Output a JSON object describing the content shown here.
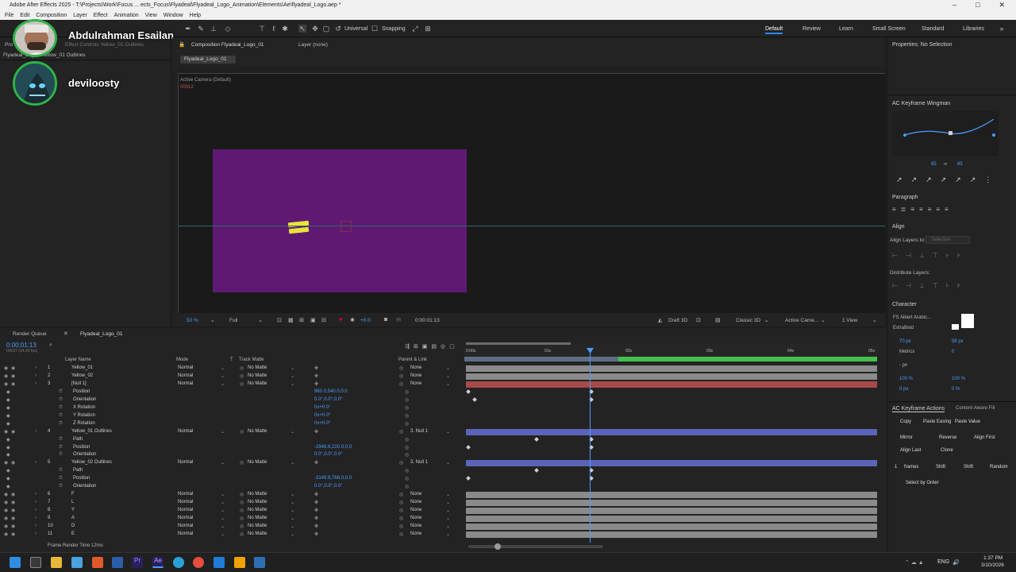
{
  "window": {
    "title": "Adobe After Effects 2025 - T:\\Projects\\Work\\Focus ... ects_Focus\\Flyadeal\\Flyadeal_Logo_Animation\\Elements\\Ae\\flyadeal_Logo.aep *",
    "menu": [
      "File",
      "Edit",
      "Composition",
      "Layer",
      "Effect",
      "Animation",
      "View",
      "Window",
      "Help"
    ]
  },
  "toolbar": {
    "universal_label": "Universal",
    "snapping_label": "Snapping",
    "workspaces": [
      "Default",
      "Review",
      "Learn",
      "Small Screen",
      "Standard",
      "Libraries"
    ],
    "active_workspace": "Default"
  },
  "overlays": {
    "user1": "Abdulrahman Esailan",
    "user2": "deviloosty"
  },
  "project_panel": {
    "label": "Pro",
    "breadcrumb": "Flyadeal_Logo • Yellow_01 Outlines",
    "effect_controls": "Effect Controls Yellow_01 Outlines"
  },
  "comp_panel": {
    "tab": "Composition Flyadeal_Logo_01",
    "layer_tab": "Layer (none)",
    "subtab": "Flyadeal_Logo_01",
    "camera_label": "Active Camera (Default)",
    "top_left_readout": "00012",
    "zoom": "50 %",
    "resolution": "Full",
    "exposure": "+0.0",
    "timecode": "0:00:01:13",
    "draft": "Draft 3D",
    "renderer": "Classic 3D",
    "camera": "Active Came...",
    "views": "1 View"
  },
  "timeline": {
    "tabs": [
      "Render Queue",
      "Flyadeal_Logo_01"
    ],
    "timecode": "0:00:01:13",
    "timecode_sub": "00037 (24.00 fps)",
    "columns": {
      "layer_name": "Layer Name",
      "mode": "Mode",
      "t": "T",
      "track_matte": "Track Matte",
      "parent": "Parent & Link"
    },
    "ruler_ticks": [
      "0:00s",
      "01s",
      "02s",
      "03s",
      "04s",
      "05s"
    ],
    "rows": [
      {
        "num": "1",
        "name": "Yellow_01",
        "mode": "Normal",
        "matte": "No Matte",
        "parent": "None",
        "bar": "#8a8a8a"
      },
      {
        "num": "2",
        "name": "Yellow_02",
        "mode": "Normal",
        "matte": "No Matte",
        "parent": "None",
        "bar": "#8a8a8a"
      },
      {
        "num": "3",
        "name": "[Null 1]",
        "mode": "Normal",
        "matte": "No Matte",
        "parent": "None",
        "bar": "#a84a4a"
      },
      {
        "prop": "Position",
        "value": "960.0,540.0,0.0"
      },
      {
        "prop": "Orientation",
        "value": "0.0°,0.0°,0.0°"
      },
      {
        "prop": "X Rotation",
        "value": "0x+0.0°"
      },
      {
        "prop": "Y Rotation",
        "value": "0x+0.0°"
      },
      {
        "prop": "Z Rotation",
        "value": "0x+0.0°"
      },
      {
        "num": "4",
        "name": "Yellow_01 Outlines",
        "mode": "Normal",
        "matte": "No Matte",
        "parent": "3. Null 1",
        "bar": "#5b64b6"
      },
      {
        "prop": "Path",
        "value": ""
      },
      {
        "prop": "Position",
        "value": "-2946.6,220.0,0.0"
      },
      {
        "prop": "Orientation",
        "value": "0.0°,0.0°,0.0°"
      },
      {
        "num": "5",
        "name": "Yellow_02 Outlines",
        "mode": "Normal",
        "matte": "No Matte",
        "parent": "3. Null 1",
        "bar": "#5b64b6"
      },
      {
        "prop": "Path",
        "value": ""
      },
      {
        "prop": "Position",
        "value": "-3149.9,766.0,0.0"
      },
      {
        "prop": "Orientation",
        "value": "0.0°,0.0°,0.0°"
      },
      {
        "num": "6",
        "name": "F",
        "mode": "Normal",
        "matte": "No Matte",
        "parent": "None",
        "bar": "#8a8a8a"
      },
      {
        "num": "7",
        "name": "L",
        "mode": "Normal",
        "matte": "No Matte",
        "parent": "None",
        "bar": "#8a8a8a"
      },
      {
        "num": "8",
        "name": "Y",
        "mode": "Normal",
        "matte": "No Matte",
        "parent": "None",
        "bar": "#8a8a8a"
      },
      {
        "num": "9",
        "name": "A",
        "mode": "Normal",
        "matte": "No Matte",
        "parent": "None",
        "bar": "#8a8a8a"
      },
      {
        "num": "10",
        "name": "D",
        "mode": "Normal",
        "matte": "No Matte",
        "parent": "None",
        "bar": "#8a8a8a"
      },
      {
        "num": "11",
        "name": "E",
        "mode": "Normal",
        "matte": "No Matte",
        "parent": "None",
        "bar": "#8a8a8a"
      }
    ],
    "footer": "Frame Render Time  12ms"
  },
  "right_panel": {
    "properties": "Properties: No Selection",
    "wingman": "AC Keyframe Wingman",
    "wingman_vals": [
      "85",
      "85"
    ],
    "paragraph": "Paragraph",
    "align": "Align",
    "align_layers_to": "Align Layers to:",
    "align_selection": "Selection",
    "distribute": "Distribute Layers:",
    "character": "Character",
    "font": "FS Albert Arabic...",
    "font_style": "ExtraBold",
    "font_size": "70 px",
    "leading": "98 px",
    "metrics": "Metrics",
    "tracking": "0",
    "scale_v": "100 %",
    "scale_h": "100 %",
    "baseline": "0 px",
    "tsume": "0 %",
    "px_label": "- px",
    "kf_actions": "AC Keyframe Actions",
    "content_aware": "Content-Aware Fill",
    "buttons": [
      "Copy",
      "Paste Easing",
      "Paste Value",
      "Mirror",
      "Reverse",
      "Align First",
      "Align Last",
      "Clone"
    ],
    "frames_num": "1",
    "frames_label": "frames",
    "shift1": "Shift",
    "shift2": "Shift",
    "random": "Random",
    "select_by_order": "Select by Order"
  },
  "taskbar": {
    "lang": "ENG",
    "time": "1:37 PM",
    "date": "3/10/2026"
  },
  "colors": {
    "comp_bg": "#5e1a73",
    "accent": "#2d8ceb",
    "yellow": "#e9e33a",
    "green_bar": "#42c24c"
  }
}
